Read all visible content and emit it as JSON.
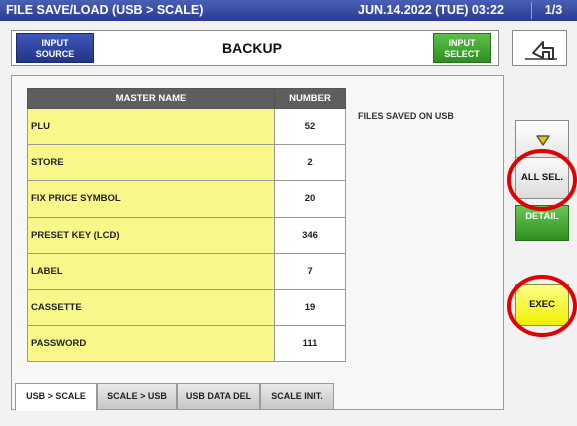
{
  "titlebar": {
    "title": "FILE SAVE/LOAD (USB > SCALE)",
    "datetime": "JUN.14.2022 (TUE) 03:22",
    "page": "1/3"
  },
  "topbar": {
    "input_source_label": [
      "INPUT",
      "SOURCE"
    ],
    "mode_title": "BACKUP",
    "input_select_label": [
      "INPUT",
      "SELECT"
    ],
    "back_icon": "return-arrow-icon"
  },
  "table": {
    "headers": [
      "MASTER NAME",
      "NUMBER"
    ],
    "rows": [
      {
        "name": "PLU",
        "number": "52"
      },
      {
        "name": "STORE",
        "number": "2"
      },
      {
        "name": "FIX PRICE SYMBOL",
        "number": "20"
      },
      {
        "name": "PRESET KEY (LCD)",
        "number": "346"
      },
      {
        "name": "LABEL",
        "number": "7"
      },
      {
        "name": "CASSETTE",
        "number": "19"
      },
      {
        "name": "PASSWORD",
        "number": "111"
      }
    ]
  },
  "info": {
    "files_saved": "FILES SAVED ON USB"
  },
  "tabs": [
    {
      "label": "USB > SCALE",
      "active": true
    },
    {
      "label": "SCALE > USB",
      "active": false
    },
    {
      "label": "USB DATA DEL",
      "active": false
    },
    {
      "label": "SCALE INIT.",
      "active": false
    }
  ],
  "side": {
    "scroll_icon": "triangle-down-icon",
    "all_sel": "ALL SEL.",
    "detail": "DETAIL",
    "exec": "EXEC"
  },
  "colors": {
    "title_bg": "#2a3b8f",
    "green": "#2e8f20",
    "yellow": "#f0f000",
    "row_name_bg": "#f7f78a",
    "annotation_red": "#e00000"
  }
}
